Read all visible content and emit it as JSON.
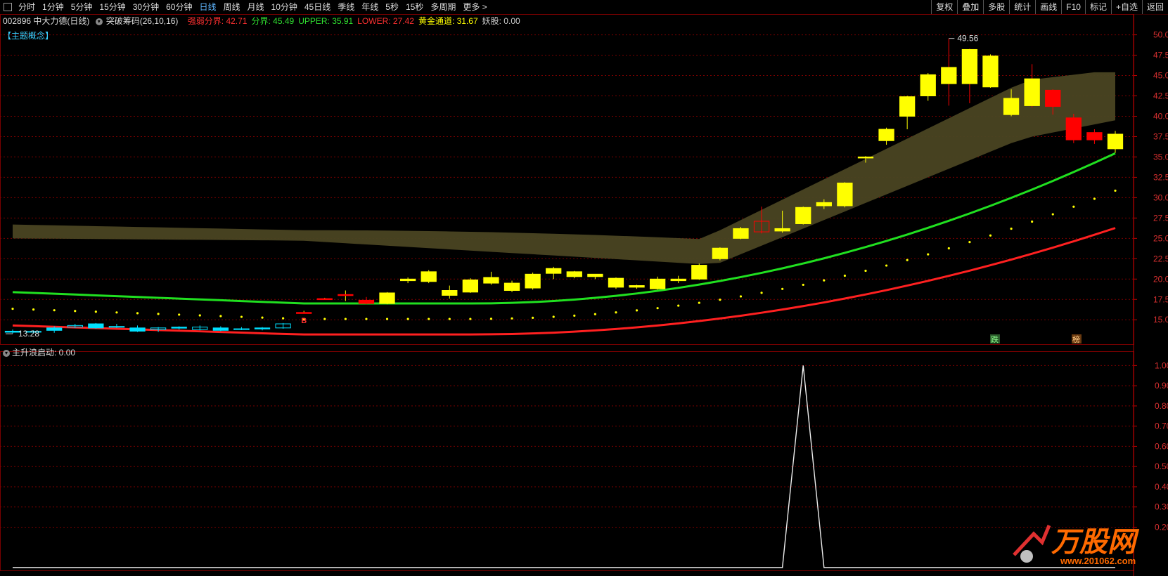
{
  "toolbar": {
    "periods": [
      "分时",
      "1分钟",
      "5分钟",
      "15分钟",
      "30分钟",
      "60分钟",
      "日线",
      "周线",
      "月线",
      "10分钟",
      "45日线",
      "季线",
      "年线",
      "5秒",
      "15秒",
      "多周期",
      "更多 >"
    ],
    "active": "日线",
    "right": [
      "复权",
      "叠加",
      "多股",
      "统计",
      "画线",
      "F10",
      "标记",
      "+自选",
      "返回"
    ]
  },
  "info": {
    "code_name": "002896 中大力德(日线)",
    "indicator": "突破筹码(26,10,16)",
    "items": [
      {
        "label": "强弱分界:",
        "value": "42.71",
        "color": "#ff3030"
      },
      {
        "label": "分界:",
        "value": "45.49",
        "color": "#30e030"
      },
      {
        "label": "UPPER:",
        "value": "35.91",
        "color": "#30e030"
      },
      {
        "label": "LOWER:",
        "value": "27.42",
        "color": "#ff3030"
      },
      {
        "label": "黄金通道:",
        "value": "31.67",
        "color": "#ffff00"
      },
      {
        "label": "妖股:",
        "value": "0.00",
        "color": "#cccccc"
      }
    ]
  },
  "topic_tag": "【主题概念】",
  "main_chart": {
    "price_axis": [
      "50.00",
      "47.50",
      "45.00",
      "42.50",
      "40.00",
      "37.50",
      "35.00",
      "32.50",
      "30.00",
      "27.50",
      "25.00",
      "22.50",
      "20.00",
      "17.50",
      "15.00"
    ],
    "high_label": "49.56",
    "low_label": "13.28",
    "markers": {
      "die": "跌",
      "bang": "榜",
      "signal": "B"
    }
  },
  "chart_data": {
    "type": "candlestick",
    "ylim": [
      12,
      51
    ],
    "candles": [
      {
        "o": 13.6,
        "h": 13.8,
        "l": 13.3,
        "c": 13.5
      },
      {
        "o": 13.5,
        "h": 13.7,
        "l": 13.3,
        "c": 13.6
      },
      {
        "o": 13.7,
        "h": 14.2,
        "l": 13.4,
        "c": 14.0
      },
      {
        "o": 14.3,
        "h": 14.5,
        "l": 14.0,
        "c": 14.1
      },
      {
        "o": 14.0,
        "h": 14.6,
        "l": 13.9,
        "c": 14.5
      },
      {
        "o": 14.2,
        "h": 14.5,
        "l": 14.0,
        "c": 14.2
      },
      {
        "o": 14.0,
        "h": 14.3,
        "l": 13.5,
        "c": 13.6
      },
      {
        "o": 13.8,
        "h": 14.1,
        "l": 13.5,
        "c": 14.0
      },
      {
        "o": 14.0,
        "h": 14.2,
        "l": 13.8,
        "c": 14.1
      },
      {
        "o": 14.1,
        "h": 14.3,
        "l": 13.7,
        "c": 13.8
      },
      {
        "o": 14.0,
        "h": 14.2,
        "l": 13.6,
        "c": 13.7
      },
      {
        "o": 13.9,
        "h": 14.1,
        "l": 13.8,
        "c": 13.9
      },
      {
        "o": 13.9,
        "h": 14.1,
        "l": 13.7,
        "c": 14.0
      },
      {
        "o": 14.0,
        "h": 14.6,
        "l": 13.9,
        "c": 14.5
      },
      {
        "o": 15.9,
        "h": 16.1,
        "l": 15.8,
        "c": 15.9
      },
      {
        "o": 17.6,
        "h": 17.7,
        "l": 17.5,
        "c": 17.6
      },
      {
        "o": 18.1,
        "h": 18.6,
        "l": 17.3,
        "c": 18.1
      },
      {
        "o": 17.4,
        "h": 17.8,
        "l": 16.9,
        "c": 17.0
      },
      {
        "o": 17.0,
        "h": 18.4,
        "l": 16.9,
        "c": 18.3
      },
      {
        "o": 19.8,
        "h": 20.2,
        "l": 19.5,
        "c": 20.0
      },
      {
        "o": 19.7,
        "h": 21.1,
        "l": 19.5,
        "c": 20.9
      },
      {
        "o": 18.0,
        "h": 19.2,
        "l": 17.6,
        "c": 18.6
      },
      {
        "o": 18.4,
        "h": 20.1,
        "l": 18.3,
        "c": 19.9
      },
      {
        "o": 19.5,
        "h": 20.9,
        "l": 19.3,
        "c": 20.2
      },
      {
        "o": 18.6,
        "h": 19.8,
        "l": 18.4,
        "c": 19.5
      },
      {
        "o": 18.9,
        "h": 20.8,
        "l": 18.7,
        "c": 20.6
      },
      {
        "o": 20.7,
        "h": 21.5,
        "l": 20.0,
        "c": 21.3
      },
      {
        "o": 20.3,
        "h": 21.0,
        "l": 20.1,
        "c": 20.9
      },
      {
        "o": 20.3,
        "h": 20.6,
        "l": 20.0,
        "c": 20.6
      },
      {
        "o": 19.0,
        "h": 20.2,
        "l": 18.8,
        "c": 20.1
      },
      {
        "o": 19.0,
        "h": 19.3,
        "l": 18.8,
        "c": 19.2
      },
      {
        "o": 18.8,
        "h": 20.3,
        "l": 18.7,
        "c": 20.0
      },
      {
        "o": 19.8,
        "h": 20.4,
        "l": 19.5,
        "c": 20.0
      },
      {
        "o": 20.0,
        "h": 21.9,
        "l": 19.9,
        "c": 21.7
      },
      {
        "o": 22.5,
        "h": 23.9,
        "l": 22.3,
        "c": 23.8
      },
      {
        "o": 25.0,
        "h": 26.4,
        "l": 24.9,
        "c": 26.2
      },
      {
        "o": 27.1,
        "h": 28.9,
        "l": 25.6,
        "c": 25.8
      },
      {
        "o": 25.9,
        "h": 28.4,
        "l": 25.7,
        "c": 26.2
      },
      {
        "o": 26.8,
        "h": 28.9,
        "l": 26.7,
        "c": 28.8
      },
      {
        "o": 29.0,
        "h": 29.8,
        "l": 28.6,
        "c": 29.4
      },
      {
        "o": 29.0,
        "h": 31.9,
        "l": 28.8,
        "c": 31.8
      },
      {
        "o": 35.0,
        "h": 35.1,
        "l": 34.3,
        "c": 35.0
      },
      {
        "o": 37.0,
        "h": 38.6,
        "l": 36.5,
        "c": 38.4
      },
      {
        "o": 40.0,
        "h": 42.5,
        "l": 38.4,
        "c": 42.4
      },
      {
        "o": 42.5,
        "h": 45.3,
        "l": 41.9,
        "c": 45.1
      },
      {
        "o": 44.0,
        "h": 49.56,
        "l": 41.3,
        "c": 46.0
      },
      {
        "o": 44.0,
        "h": 48.3,
        "l": 41.6,
        "c": 48.2
      },
      {
        "o": 43.6,
        "h": 47.6,
        "l": 43.5,
        "c": 47.4
      },
      {
        "o": 40.2,
        "h": 43.3,
        "l": 40.0,
        "c": 42.2
      },
      {
        "o": 41.3,
        "h": 46.4,
        "l": 41.1,
        "c": 44.6
      },
      {
        "o": 43.2,
        "h": 43.3,
        "l": 40.2,
        "c": 41.2
      },
      {
        "o": 39.8,
        "h": 40.3,
        "l": 36.7,
        "c": 37.1
      },
      {
        "o": 38.0,
        "h": 38.4,
        "l": 36.6,
        "c": 37.1
      },
      {
        "o": 36.0,
        "h": 38.2,
        "l": 35.5,
        "c": 37.8
      }
    ],
    "sub_chart": {
      "title": "主升浪启动",
      "value": "0.00",
      "ylim": [
        0,
        1.05
      ],
      "axis": [
        "1.00",
        "0.90",
        "0.80",
        "0.70",
        "0.60",
        "0.50",
        "0.40",
        "0.30",
        "0.20"
      ],
      "spike_index": 38,
      "spike_value": 1.0
    }
  },
  "sub_header": {
    "title": "主升浪启动",
    "value": ": 0.00"
  },
  "watermark": {
    "brand": "万股网",
    "url": "www.201062.com"
  },
  "colors": {
    "up": "#ffff00",
    "down": "#ff0000",
    "flat_up": "#00e0ff",
    "green_line": "#20e020",
    "red_line": "#ff2020",
    "dots": "#ffff00",
    "band": "#4a4422",
    "grid": "#7a0000"
  }
}
